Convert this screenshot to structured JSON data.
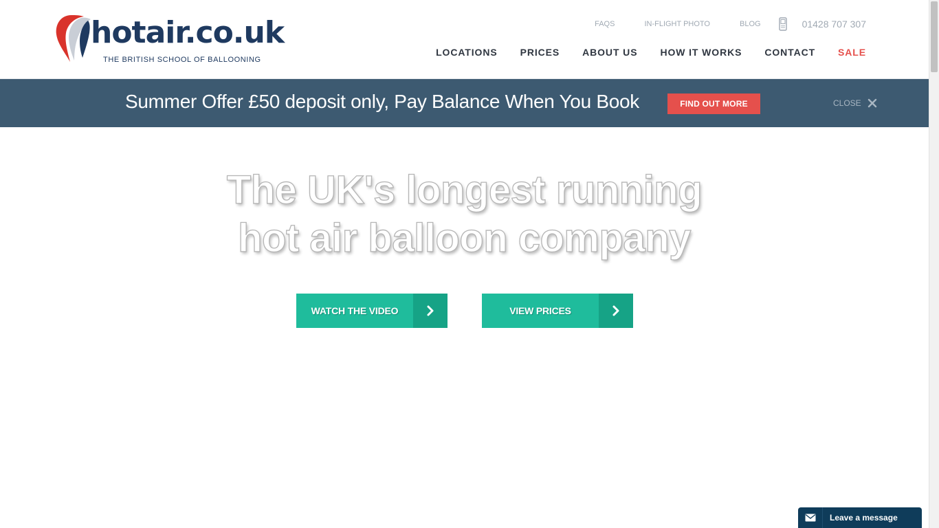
{
  "header": {
    "logo_text": "hotair.co.uk",
    "logo_tagline": "THE BRITISH SCHOOL OF BALLOONING",
    "top_links": [
      {
        "label": "FAQS"
      },
      {
        "label": "IN-FLIGHT PHOTO"
      },
      {
        "label": "BLOG"
      }
    ],
    "phone_icon": "mobile-phone-icon",
    "phone": "01428 707 307",
    "nav": [
      {
        "label": "LOCATIONS"
      },
      {
        "label": "PRICES"
      },
      {
        "label": "ABOUT US"
      },
      {
        "label": "HOW IT WORKS"
      },
      {
        "label": "CONTACT"
      },
      {
        "label": "SALE"
      }
    ]
  },
  "banner": {
    "text": "Summer Offer £50 deposit only, Pay Balance When You Book",
    "button": "FIND OUT MORE",
    "close_label": "CLOSE",
    "close_icon": "close-icon"
  },
  "hero": {
    "title_line1": "The UK's longest running",
    "title_line2": "hot air balloon company",
    "buttons": [
      {
        "label": "WATCH THE VIDEO",
        "icon": "chevron-right-icon"
      },
      {
        "label": "VIEW PRICES",
        "icon": "chevron-right-icon"
      }
    ]
  },
  "chat": {
    "icon": "envelope-icon",
    "label": "Leave a message"
  },
  "colors": {
    "brand_navy": "#1f3a60",
    "logo_red": "#d9332b",
    "banner_bg": "#3d5a71",
    "accent_red": "#e5504c",
    "cta_green": "#1fbc9c",
    "cta_green_dark": "#16a386",
    "chat_bg": "#0f3c5a"
  }
}
